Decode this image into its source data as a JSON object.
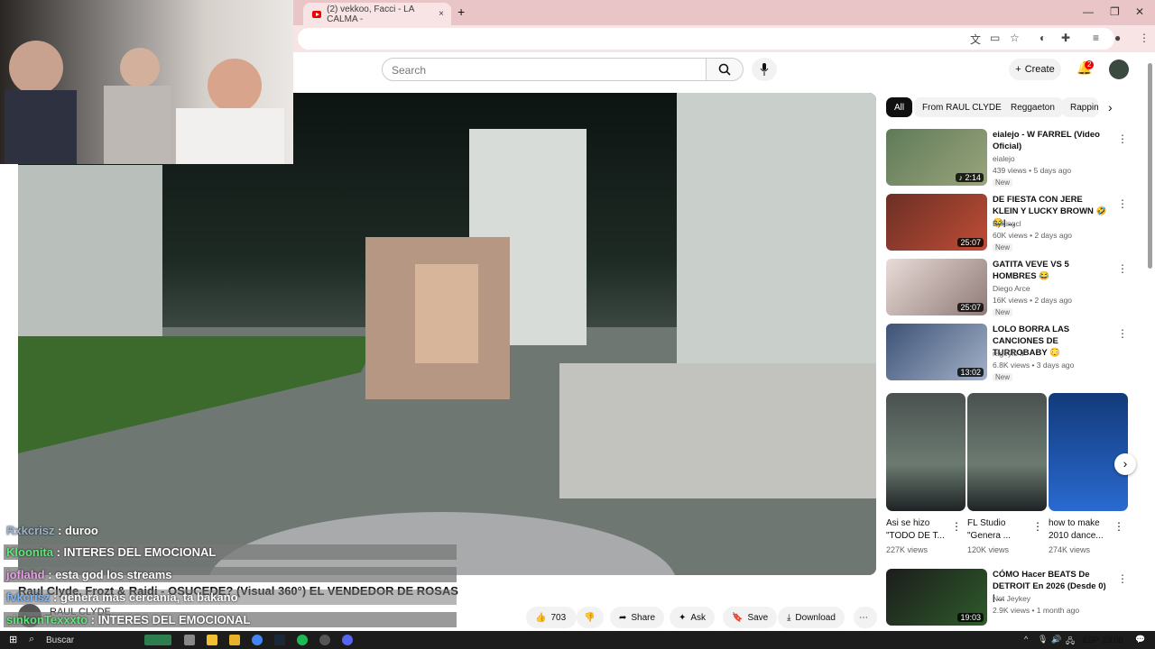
{
  "browser": {
    "tab_title": "(2) vekkoo, Facci - LA CALMA -",
    "tab_close": "×",
    "new_tab": "+"
  },
  "header": {
    "search_placeholder": "Search",
    "create_label": "Create",
    "notification_count": "2"
  },
  "chat": {
    "messages": [
      {
        "user": "Rxkcrisz",
        "text": " : duroo"
      },
      {
        "user": "Kloonita",
        "text": " : INTERES DEL EMOCIONAL"
      },
      {
        "user": "joflahd",
        "text": " : esta god los streams"
      },
      {
        "user": "fvkcrisz",
        "text": " : genera mas cercania, ta bakano"
      },
      {
        "user": "sinkonTexxxto",
        "text": " : INTERES DEL EMOCIONAL"
      }
    ]
  },
  "video": {
    "title": "Raul Clyde, Frozt & Raidi - OSUCEDE? (Visual 360°) EL VENDEDOR DE ROSAS",
    "channel": "RAUL CLYDE"
  },
  "actions": {
    "likes": "703",
    "share": "Share",
    "ask": "Ask",
    "save": "Save",
    "download": "Download"
  },
  "chips": [
    "All",
    "From RAUL CLYDE",
    "Reggaeton",
    "Rappin"
  ],
  "recommendations": [
    {
      "title": "eialejo - W FARREL (Video Oficial)",
      "channel": "eialejo",
      "meta": "439 views • 5 days ago",
      "badge": "New",
      "duration": "♪ 2:14"
    },
    {
      "title": "DE FIESTA CON JERE KLEIN Y LUCKY BROWN 🤣😂| ...",
      "channel": "Bykingcl",
      "meta": "60K views • 2 days ago",
      "badge": "New",
      "duration": "25:07"
    },
    {
      "title": "GATITA VEVE VS 5 HOMBRES 😂",
      "channel": "Diego Arce",
      "meta": "16K views • 2 days ago",
      "badge": "New",
      "duration": "25:07"
    },
    {
      "title": "LOLO BORRA LAS CANCIONES DE TURROBABY 😳",
      "channel": "rageylo fr",
      "meta": "6.8K views • 3 days ago",
      "badge": "New",
      "duration": "13:02"
    }
  ],
  "shorts": [
    {
      "title": "Asi se hizo \"TODO DE T...",
      "views": "227K views"
    },
    {
      "title": "FL Studio \"Genera ...",
      "views": "120K views"
    },
    {
      "title": "how to make 2010 dance...",
      "views": "274K views"
    }
  ],
  "bottom_rec": {
    "title": "CÓMO Hacer BEATS De DETROIT En 2026 (Desde 0) | ...",
    "channel": "Not Jeykey",
    "meta": "2.9K views • 1 month ago",
    "duration": "19:03"
  },
  "taskbar": {
    "search": "Buscar",
    "lang": "ESP",
    "time": "23:08"
  },
  "colors": {
    "tab_strip": "#eac5c8",
    "toolbar": "#f9e4e5",
    "yt_red": "#ee0000"
  }
}
